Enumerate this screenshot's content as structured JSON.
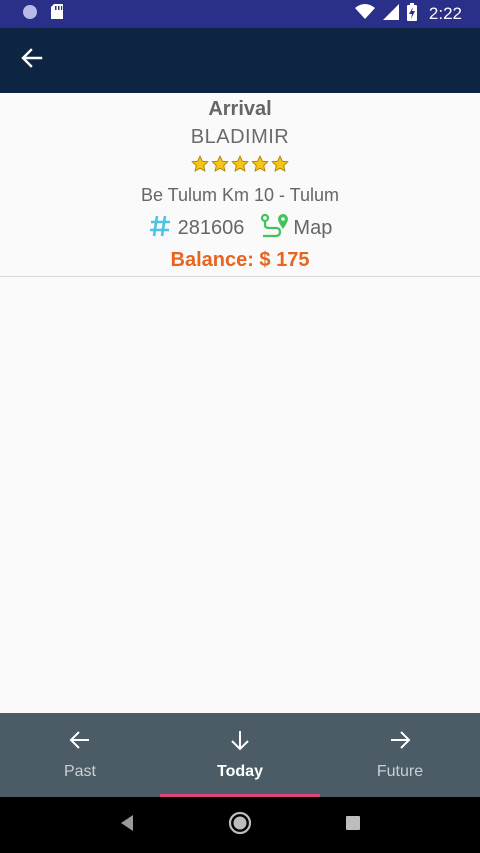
{
  "status_bar": {
    "time": "2:22",
    "icons": [
      "notification-dot-icon",
      "sd-card-icon",
      "wifi-icon",
      "signal-icon",
      "battery-charging-icon"
    ]
  },
  "app_bar": {
    "back_icon": "arrow-back-icon"
  },
  "reservation": {
    "type_label": "Arrival",
    "guest_name": "BLADIMIR",
    "stars": 5,
    "address": "Be Tulum Km 10 - Tulum",
    "number_icon": "hash-icon",
    "reservation_number": "281606",
    "map_icon": "route-map-icon",
    "map_label": "Map",
    "balance": "Balance: $ 175",
    "colors": {
      "hash": "#4bc3e6",
      "map": "#3ec45a",
      "balance": "#e8641f",
      "star": "#f5c518"
    }
  },
  "bottom_nav": {
    "items": [
      {
        "label": "Past",
        "icon": "arrow-left-icon"
      },
      {
        "label": "Today",
        "icon": "arrow-down-icon"
      },
      {
        "label": "Future",
        "icon": "arrow-right-icon"
      }
    ],
    "active": "Today",
    "indicator_color": "#e0457a"
  },
  "system_nav": {
    "icons": [
      "back-triangle-icon",
      "home-circle-icon",
      "recents-square-icon"
    ]
  }
}
